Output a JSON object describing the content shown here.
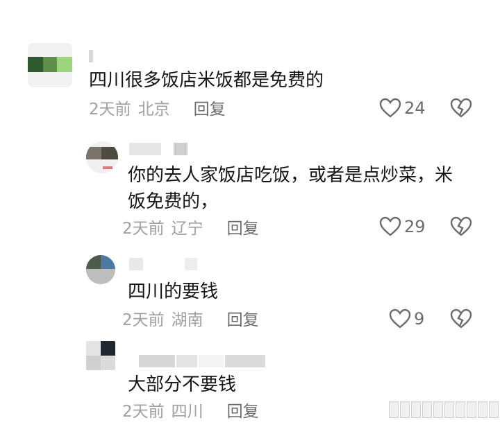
{
  "comments": [
    {
      "text": "四川很多饭店米饭都是免费的",
      "time": "2天前",
      "location": "北京",
      "reply": "回复",
      "likes": "24",
      "icons": {
        "like": "heart-outline-icon",
        "dislike": "broken-heart-icon"
      }
    },
    {
      "text": "你的去人家饭店吃饭，或者是点炒菜，米饭免费的，",
      "time": "2天前",
      "location": "辽宁",
      "reply": "回复",
      "likes": "29"
    },
    {
      "text": "四川的要钱",
      "time": "2天前",
      "location": "湖南",
      "reply": "回复",
      "likes": "9"
    },
    {
      "text": "大部分不要钱",
      "time": "2天前",
      "location": "四川",
      "reply": "回复"
    }
  ],
  "colors": {
    "text": "#151515",
    "meta": "#a0a0a0",
    "reply": "#6a6a6a",
    "icon": "#6b6b6b"
  }
}
